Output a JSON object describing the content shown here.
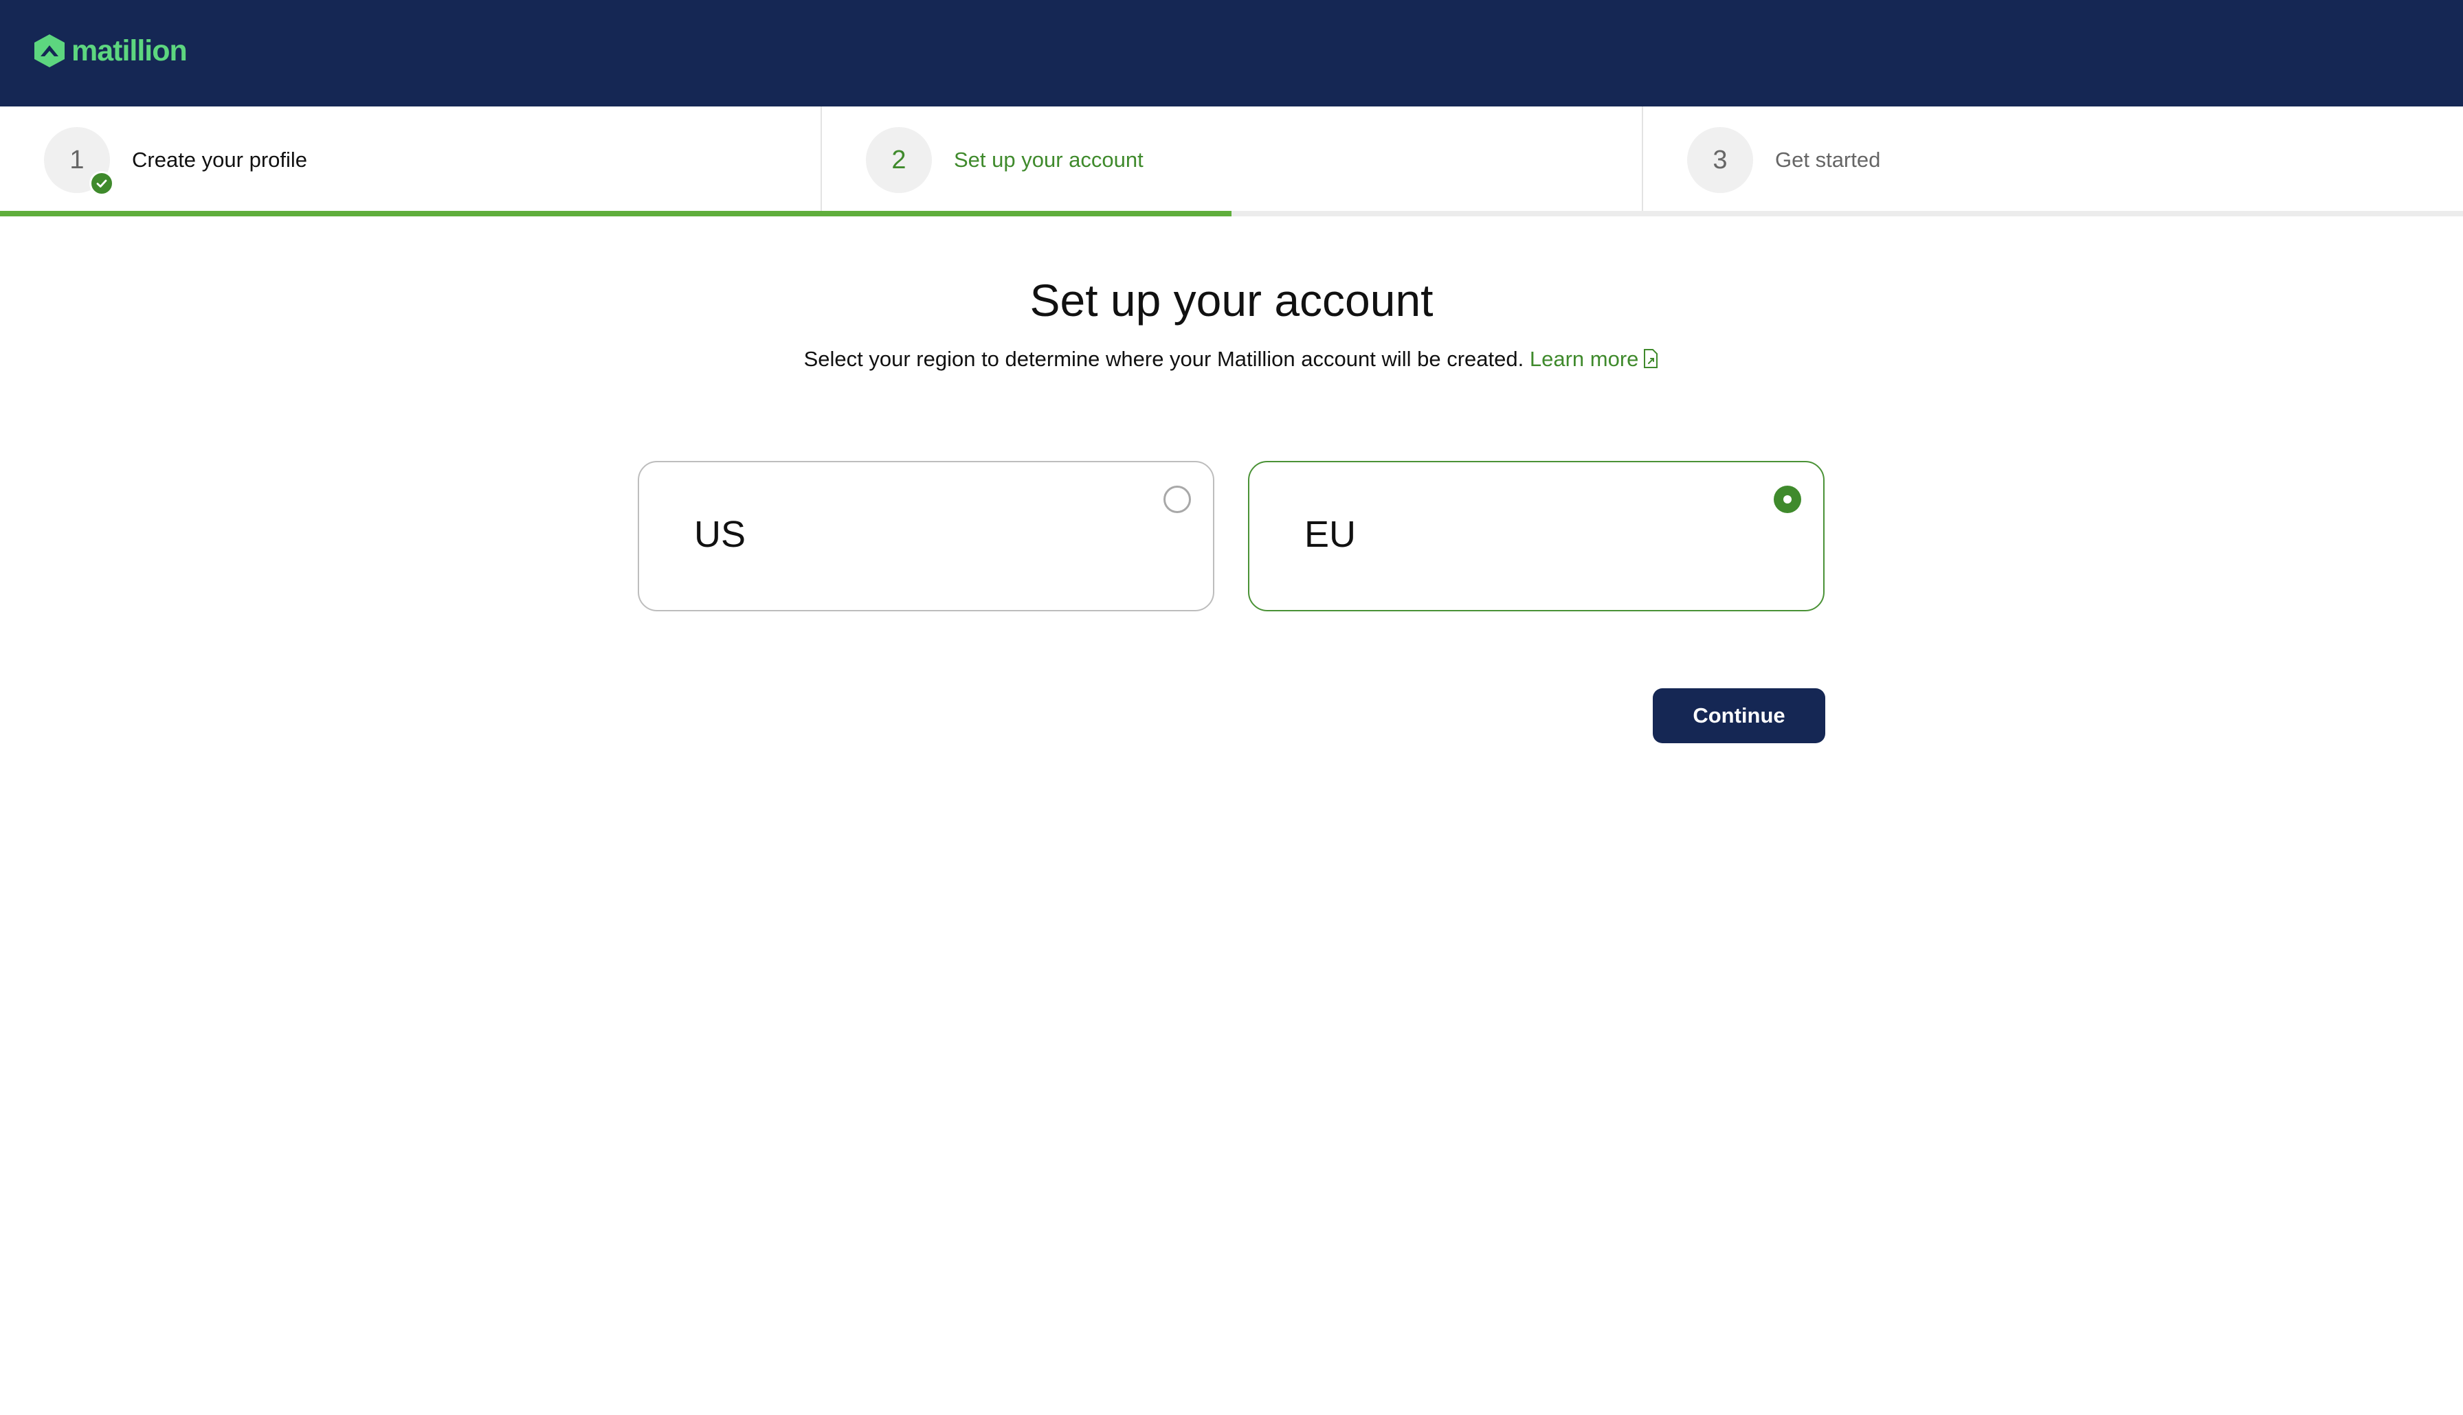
{
  "header": {
    "logo_text": "matillion",
    "logo_icon": "matillion-logo-icon"
  },
  "stepper": {
    "progress_fraction": 0.5,
    "steps": [
      {
        "number": "1",
        "label": "Create your profile",
        "status": "complete"
      },
      {
        "number": "2",
        "label": "Set up your account",
        "status": "current"
      },
      {
        "number": "3",
        "label": "Get started",
        "status": "upcoming"
      }
    ]
  },
  "main": {
    "title": "Set up your account",
    "subtitle": "Select your region to determine where your Matillion account will be created.",
    "learn_more_label": "Learn more",
    "learn_more_icon": "external-document-icon"
  },
  "regions": [
    {
      "label": "US",
      "selected": false
    },
    {
      "label": "EU",
      "selected": true
    }
  ],
  "actions": {
    "continue_label": "Continue"
  },
  "colors": {
    "navy": "#152754",
    "accent_green": "#3f8a2c",
    "logo_green": "#5dd67f",
    "progress_green": "#5fae3c"
  }
}
